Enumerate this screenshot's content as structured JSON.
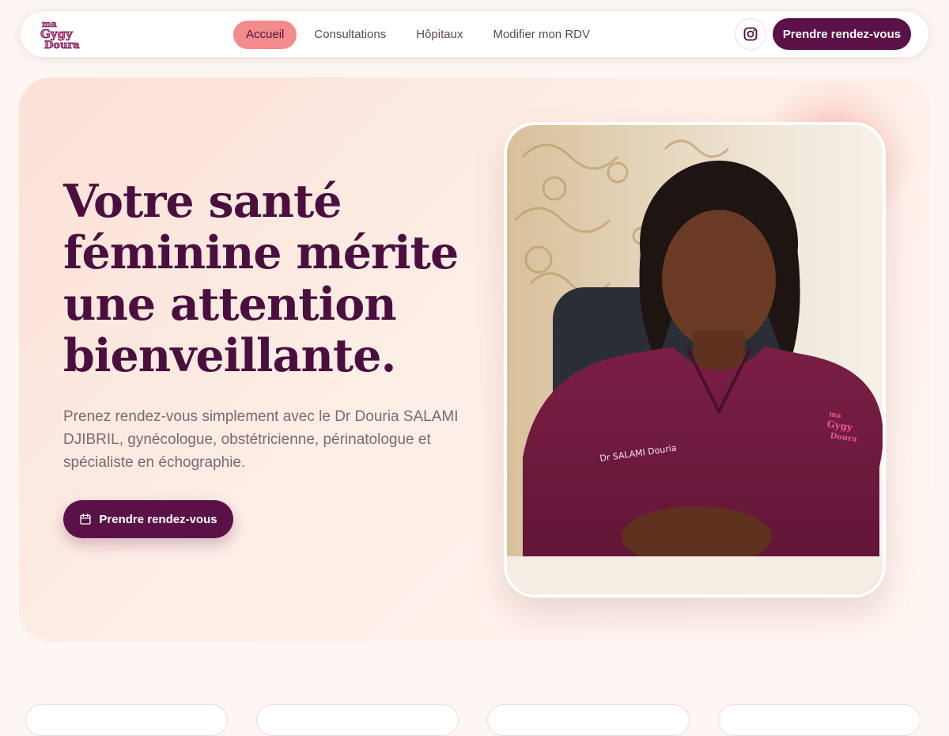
{
  "brand": {
    "logo_lines": [
      "ma",
      "Gygy",
      "Doura"
    ],
    "logo_color": "#e8589a"
  },
  "nav": {
    "items": [
      {
        "label": "Accueil",
        "active": true
      },
      {
        "label": "Consultations",
        "active": false
      },
      {
        "label": "Hôpitaux",
        "active": false
      },
      {
        "label": "Modifier mon RDV",
        "active": false
      }
    ],
    "instagram_icon": "instagram-icon",
    "cta_label": "Prendre rendez-vous"
  },
  "hero": {
    "title": "Votre santé féminine mérite une attention bienveillante.",
    "subtitle": "Prenez rendez-vous simplement avec le Dr Douria SALAMI DJIBRIL, gynécologue, obstétricienne, périnatologue et spécialiste en échographie.",
    "cta_label": "Prendre rendez-vous",
    "cta_icon": "calendar-icon",
    "photo": {
      "scrub_label": "Dr SALAMI Douria",
      "patch_lines": [
        "ma",
        "Gygy",
        "Doura"
      ]
    }
  },
  "colors": {
    "primary": "#5a1148",
    "accent": "#f48b8b",
    "title": "#4a0f3f",
    "text_muted": "#7a6a72"
  }
}
